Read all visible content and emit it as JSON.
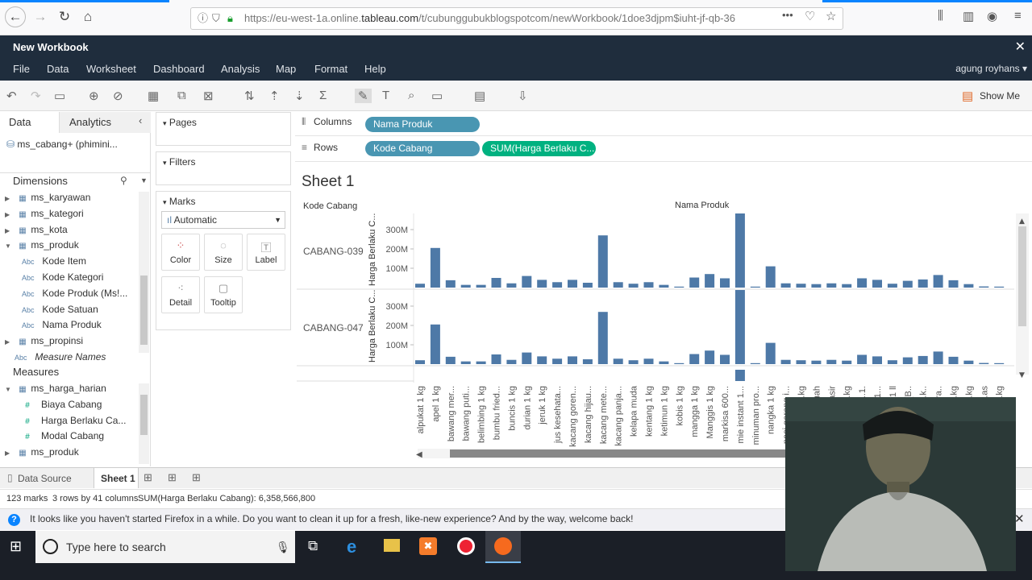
{
  "browser": {
    "url_prefix": "https://eu-west-1a.online.",
    "url_host": "tableau.com",
    "url_rest": "/t/cubunggubukblogspotcom/newWorkbook/1doe3djpm$iuht-jf-qb-36",
    "more": "•••"
  },
  "app": {
    "title": "New Workbook",
    "user": "agung royhans ▾",
    "menu": [
      "File",
      "Data",
      "Worksheet",
      "Dashboard",
      "Analysis",
      "Map",
      "Format",
      "Help"
    ],
    "show_me": "Show Me"
  },
  "datapane": {
    "tab_data": "Data",
    "tab_analytics": "Analytics",
    "datasource": "ms_cabang+ (phimini...",
    "dimensions_header": "Dimensions",
    "dimensions": [
      {
        "label": "ms_karyawan",
        "kind": "table",
        "indent": 0
      },
      {
        "label": "ms_kategori",
        "kind": "table",
        "indent": 0
      },
      {
        "label": "ms_kota",
        "kind": "table",
        "indent": 0
      },
      {
        "label": "ms_produk",
        "kind": "table",
        "indent": 0
      },
      {
        "label": "Kode Item",
        "kind": "abc",
        "indent": 1
      },
      {
        "label": "Kode Kategori",
        "kind": "abc",
        "indent": 1
      },
      {
        "label": "Kode Produk (Ms!...",
        "kind": "abc",
        "indent": 1
      },
      {
        "label": "Kode Satuan",
        "kind": "abc",
        "indent": 1
      },
      {
        "label": "Nama Produk",
        "kind": "abc",
        "indent": 1
      },
      {
        "label": "ms_propinsi",
        "kind": "table",
        "indent": 0
      },
      {
        "label": "Measure Names",
        "kind": "abc",
        "indent": 0
      }
    ],
    "measures_header": "Measures",
    "measures": [
      {
        "label": "ms_harga_harian",
        "kind": "table",
        "indent": 0
      },
      {
        "label": "Biaya Cabang",
        "kind": "num",
        "indent": 1
      },
      {
        "label": "Harga Berlaku Ca...",
        "kind": "num",
        "indent": 1
      },
      {
        "label": "Modal Cabang",
        "kind": "num",
        "indent": 1
      },
      {
        "label": "ms_produk",
        "kind": "table",
        "indent": 0
      }
    ]
  },
  "cards": {
    "pages": "Pages",
    "filters": "Filters",
    "marks": "Marks",
    "mark_type": "Automatic",
    "buttons": [
      "Color",
      "Size",
      "Label",
      "Detail",
      "Tooltip"
    ]
  },
  "shelves": {
    "columns_label": "Columns",
    "rows_label": "Rows",
    "columns_pill": "Nama Produk",
    "rows_pill_1": "Kode Cabang",
    "rows_pill_2": "SUM(Harga Berlaku C..."
  },
  "sheet": {
    "title": "Sheet 1",
    "row_header": "Kode Cabang",
    "col_header": "Nama Produk"
  },
  "tabs": {
    "data_source": "Data Source",
    "sheet": "Sheet 1"
  },
  "status": {
    "marks": "123 marks",
    "dims": "3 rows by 41 columns",
    "sum": "SUM(Harga Berlaku Cabang): 6,358,566,800"
  },
  "notification": "It looks like you haven't started Firefox in a while. Do you want to clean it up for a fresh, like-new experience? And by the way, welcome back!",
  "taskbar": {
    "search_placeholder": "Type here to search"
  },
  "colors": {
    "bar": "#4e79a7",
    "dim_pill": "#4996b2",
    "measure_pill": "#00b180",
    "header_dark": "#1f2d3d"
  },
  "chart_data": {
    "type": "bar",
    "ylabel": "Harga Berlaku C...",
    "yticks": [
      "100M",
      "200M",
      "300M"
    ],
    "categories": [
      "alpukat 1 kg",
      "apel 1 kg",
      "bawang mer...",
      "bawang puti...",
      "belimbing 1 kg",
      "bumbu fried...",
      "buncis 1 kg",
      "durian 1 kg",
      "jeruk 1 kg",
      "jus kesehata...",
      "kacang goren...",
      "kacang hijau...",
      "kacang mete...",
      "kacang panja...",
      "kelapa muda",
      "kentang 1 kg",
      "ketimun 1 kg",
      "kobis 1 kg",
      "mangga 1 kg",
      "Manggis 1 kg",
      "markisa 600...",
      "mie instant 1...",
      "minuman pro...",
      "nangka 1 kg",
      "nasi goreng i...",
      "..kg",
      "..uah",
      "..asir",
      "..kg",
      "..1.",
      "..1...",
      "..1 ll",
      "..(B..",
      "..k..",
      "..ra..",
      "..kg",
      "..kg",
      "..as",
      "..kg"
    ],
    "series": [
      {
        "name": "CABANG-039",
        "values": [
          20,
          205,
          38,
          14,
          14,
          50,
          22,
          60,
          40,
          28,
          40,
          25,
          270,
          28,
          20,
          28,
          14,
          5,
          52,
          70,
          48,
          480,
          5,
          110,
          22,
          20,
          18,
          22,
          18,
          48,
          40,
          20,
          35,
          42,
          65,
          38,
          18,
          6,
          5,
          10
        ]
      },
      {
        "name": "CABANG-047",
        "values": [
          20,
          205,
          38,
          14,
          14,
          50,
          22,
          60,
          40,
          28,
          40,
          25,
          270,
          28,
          20,
          28,
          14,
          5,
          52,
          70,
          48,
          480,
          5,
          110,
          22,
          20,
          18,
          22,
          18,
          48,
          40,
          20,
          35,
          42,
          65,
          38,
          18,
          6,
          5,
          10
        ]
      }
    ],
    "ylim": [
      0,
      360
    ]
  }
}
